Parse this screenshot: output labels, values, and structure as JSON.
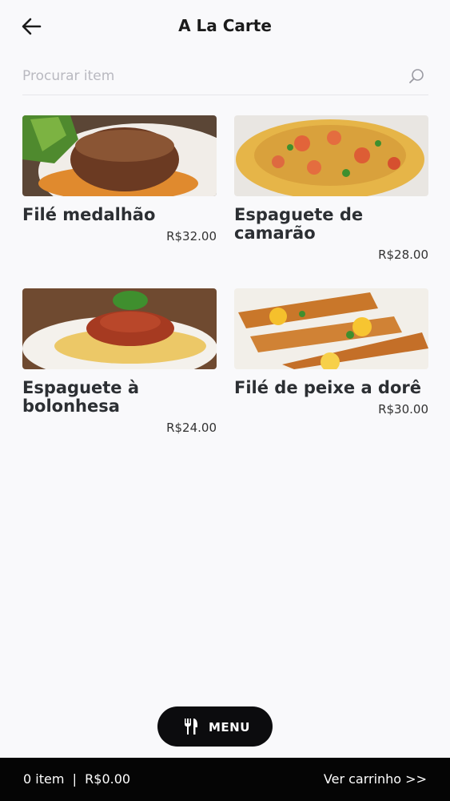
{
  "header": {
    "title": "A La Carte",
    "back_icon": "arrow-left-icon"
  },
  "search": {
    "placeholder": "Procurar item",
    "value": "",
    "icon": "search-icon"
  },
  "items": [
    {
      "name": "Filé medalhão",
      "price": "R$32.00"
    },
    {
      "name": "Espaguete de camarão",
      "price": "R$28.00"
    },
    {
      "name": "Espaguete à bolonhesa",
      "price": "R$24.00"
    },
    {
      "name": "Filé de peixe a dorê",
      "price": "R$30.00"
    }
  ],
  "menu_button": {
    "label": "MENU",
    "icon": "fork-knife-icon"
  },
  "footer": {
    "cart_summary": "0 item  |  R$0.00",
    "view_cart": "Ver carrinho >>"
  },
  "colors": {
    "background": "#f9f9fb",
    "footer": "#050505",
    "menu_button": "#0c0c0e",
    "text": "#2c2f33"
  }
}
